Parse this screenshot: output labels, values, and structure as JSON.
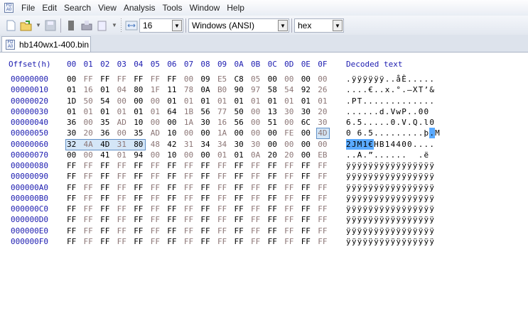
{
  "menu": [
    "File",
    "Edit",
    "Search",
    "View",
    "Analysis",
    "Tools",
    "Window",
    "Help"
  ],
  "toolbar": {
    "bytes_per_row": "16",
    "charset": "Windows (ANSI)",
    "offset_base": "hex"
  },
  "tab": {
    "filename": "hb140wx1-400.bin"
  },
  "header": {
    "offset_label": "Offset(h)",
    "columns": [
      "00",
      "01",
      "02",
      "03",
      "04",
      "05",
      "06",
      "07",
      "08",
      "09",
      "0A",
      "0B",
      "0C",
      "0D",
      "0E",
      "0F"
    ],
    "decoded_label": "Decoded text"
  },
  "selection": {
    "start": "5F",
    "end": "64"
  },
  "colors": {
    "offset": "#1c1cb0",
    "odd_column": "#8c7676",
    "selection": "#3399ff"
  },
  "rows": [
    {
      "offset": "00000000",
      "bytes": [
        "00",
        "FF",
        "FF",
        "FF",
        "FF",
        "FF",
        "FF",
        "00",
        "09",
        "E5",
        "C8",
        "05",
        "00",
        "00",
        "00",
        "00"
      ],
      "text": ".ÿÿÿÿÿÿ..åÈ....."
    },
    {
      "offset": "00000010",
      "bytes": [
        "01",
        "16",
        "01",
        "04",
        "80",
        "1F",
        "11",
        "78",
        "0A",
        "B0",
        "90",
        "97",
        "58",
        "54",
        "92",
        "26"
      ],
      "text": "....€..x.°.—XT’&"
    },
    {
      "offset": "00000020",
      "bytes": [
        "1D",
        "50",
        "54",
        "00",
        "00",
        "00",
        "01",
        "01",
        "01",
        "01",
        "01",
        "01",
        "01",
        "01",
        "01",
        "01"
      ],
      "text": ".PT............."
    },
    {
      "offset": "00000030",
      "bytes": [
        "01",
        "01",
        "01",
        "01",
        "01",
        "01",
        "64",
        "1B",
        "56",
        "77",
        "50",
        "00",
        "13",
        "30",
        "30",
        "20"
      ],
      "text": "......d.VwP..00 "
    },
    {
      "offset": "00000040",
      "bytes": [
        "36",
        "00",
        "35",
        "AD",
        "10",
        "00",
        "00",
        "1A",
        "30",
        "16",
        "56",
        "00",
        "51",
        "00",
        "6C",
        "30"
      ],
      "text": "6.5.....0.V.Q.l0"
    },
    {
      "offset": "00000050",
      "bytes": [
        "30",
        "20",
        "36",
        "00",
        "35",
        "AD",
        "10",
        "00",
        "00",
        "1A",
        "00",
        "00",
        "00",
        "FE",
        "00",
        "4D"
      ],
      "text": "0 6.5.........þ.M"
    },
    {
      "offset": "00000060",
      "bytes": [
        "32",
        "4A",
        "4D",
        "31",
        "80",
        "48",
        "42",
        "31",
        "34",
        "34",
        "30",
        "30",
        "00",
        "00",
        "00",
        "00"
      ],
      "text": "2JM1€HB14400...."
    },
    {
      "offset": "00000070",
      "bytes": [
        "00",
        "00",
        "41",
        "01",
        "94",
        "00",
        "10",
        "00",
        "00",
        "01",
        "01",
        "0A",
        "20",
        "20",
        "00",
        "EB"
      ],
      "text": "..A.”......  .ë"
    },
    {
      "offset": "00000080",
      "bytes": [
        "FF",
        "FF",
        "FF",
        "FF",
        "FF",
        "FF",
        "FF",
        "FF",
        "FF",
        "FF",
        "FF",
        "FF",
        "FF",
        "FF",
        "FF",
        "FF"
      ],
      "text": "ÿÿÿÿÿÿÿÿÿÿÿÿÿÿÿÿ"
    },
    {
      "offset": "00000090",
      "bytes": [
        "FF",
        "FF",
        "FF",
        "FF",
        "FF",
        "FF",
        "FF",
        "FF",
        "FF",
        "FF",
        "FF",
        "FF",
        "FF",
        "FF",
        "FF",
        "FF"
      ],
      "text": "ÿÿÿÿÿÿÿÿÿÿÿÿÿÿÿÿ"
    },
    {
      "offset": "000000A0",
      "bytes": [
        "FF",
        "FF",
        "FF",
        "FF",
        "FF",
        "FF",
        "FF",
        "FF",
        "FF",
        "FF",
        "FF",
        "FF",
        "FF",
        "FF",
        "FF",
        "FF"
      ],
      "text": "ÿÿÿÿÿÿÿÿÿÿÿÿÿÿÿÿ"
    },
    {
      "offset": "000000B0",
      "bytes": [
        "FF",
        "FF",
        "FF",
        "FF",
        "FF",
        "FF",
        "FF",
        "FF",
        "FF",
        "FF",
        "FF",
        "FF",
        "FF",
        "FF",
        "FF",
        "FF"
      ],
      "text": "ÿÿÿÿÿÿÿÿÿÿÿÿÿÿÿÿ"
    },
    {
      "offset": "000000C0",
      "bytes": [
        "FF",
        "FF",
        "FF",
        "FF",
        "FF",
        "FF",
        "FF",
        "FF",
        "FF",
        "FF",
        "FF",
        "FF",
        "FF",
        "FF",
        "FF",
        "FF"
      ],
      "text": "ÿÿÿÿÿÿÿÿÿÿÿÿÿÿÿÿ"
    },
    {
      "offset": "000000D0",
      "bytes": [
        "FF",
        "FF",
        "FF",
        "FF",
        "FF",
        "FF",
        "FF",
        "FF",
        "FF",
        "FF",
        "FF",
        "FF",
        "FF",
        "FF",
        "FF",
        "FF"
      ],
      "text": "ÿÿÿÿÿÿÿÿÿÿÿÿÿÿÿÿ"
    },
    {
      "offset": "000000E0",
      "bytes": [
        "FF",
        "FF",
        "FF",
        "FF",
        "FF",
        "FF",
        "FF",
        "FF",
        "FF",
        "FF",
        "FF",
        "FF",
        "FF",
        "FF",
        "FF",
        "FF"
      ],
      "text": "ÿÿÿÿÿÿÿÿÿÿÿÿÿÿÿÿ"
    },
    {
      "offset": "000000F0",
      "bytes": [
        "FF",
        "FF",
        "FF",
        "FF",
        "FF",
        "FF",
        "FF",
        "FF",
        "FF",
        "FF",
        "FF",
        "FF",
        "FF",
        "FF",
        "FF",
        "FF"
      ],
      "text": "ÿÿÿÿÿÿÿÿÿÿÿÿÿÿÿÿ"
    }
  ]
}
